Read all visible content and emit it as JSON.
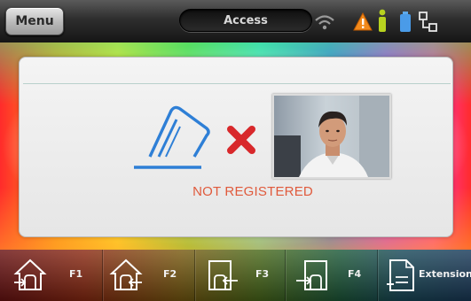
{
  "topbar": {
    "menu_label": "Menu",
    "title": "Access",
    "status_icons": [
      "wifi-icon",
      "warning-icon",
      "user-status-icon",
      "battery-icon",
      "network-icon"
    ]
  },
  "main": {
    "status_text": "NOT REGISTERED",
    "colors": {
      "status": "#e05a3c",
      "error_x": "#d8282b",
      "fingerprint": "#2e7fd6"
    }
  },
  "function_keys": [
    {
      "label": "F1",
      "icon": "enter-door-icon"
    },
    {
      "label": "F2",
      "icon": "home-return-icon"
    },
    {
      "label": "F3",
      "icon": "exit-door-icon"
    },
    {
      "label": "F4",
      "icon": "enter-arrow-icon"
    },
    {
      "label": "Extension",
      "icon": "document-add-icon"
    }
  ]
}
